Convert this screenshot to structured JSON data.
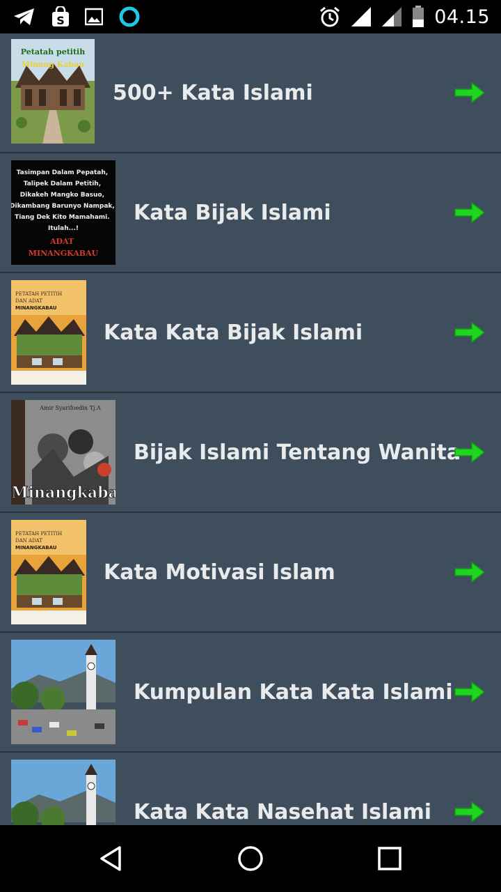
{
  "status_bar": {
    "time": "04.15",
    "left_icons": [
      "telegram-icon",
      "shopping-bag-icon",
      "image-icon",
      "circle-app-icon"
    ],
    "right_icons": [
      "alarm-icon",
      "signal-icon",
      "signal-icon-2",
      "battery-icon"
    ]
  },
  "items": [
    {
      "title": "500+ Kata Islami",
      "thumb_text": "Petatah petitih Minang Kabau",
      "thumb": "rumah-gadang-photo"
    },
    {
      "title": "Kata Bijak Islami",
      "thumb_text": "Tasimpan Dalam Pepatah, Talipek Dalam Petitih, Dikakeh Mangko Basuo, Dikambang Barunyo Nampak, Tiang Dek Kito Mamahami, Itulah...! ADAT MINANGKABAU",
      "thumb": "black-quote-card"
    },
    {
      "title": "Kata Kata Bijak Islami",
      "thumb_text": "PETATAH PETITIH DAN ADAT MINANGKABAU",
      "thumb": "book-cover"
    },
    {
      "title": "Bijak Islami Tentang Wanita",
      "thumb_text": "Minangkabau",
      "thumb": "book-cover-bw"
    },
    {
      "title": "Kata Motivasi Islam",
      "thumb_text": "PETATAH PETITIH DAN ADAT MINANGKABAU",
      "thumb": "book-cover"
    },
    {
      "title": "Kumpulan Kata Kata Islami",
      "thumb_text": "",
      "thumb": "clock-tower-photo"
    },
    {
      "title": "Kata Kata Nasehat Islami",
      "thumb_text": "",
      "thumb": "clock-tower-photo"
    }
  ],
  "nav_bar": {
    "icons": [
      "back-icon",
      "home-icon",
      "recents-icon"
    ]
  },
  "colors": {
    "list_bg": "#3f4e5c",
    "arrow": "#1fd51f",
    "text": "#e8eaec"
  }
}
